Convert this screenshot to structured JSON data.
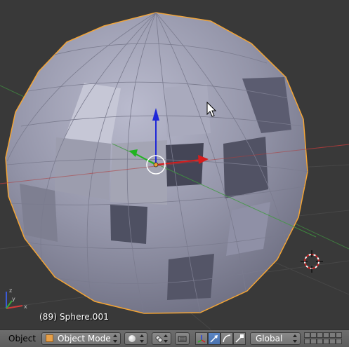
{
  "viewport": {
    "object_label": "(89) Sphere.001",
    "selection_outline_color": "#f5a534",
    "background_color": "#393939"
  },
  "header": {
    "menu_label": "Object",
    "mode_select": {
      "value": "Object Mode",
      "icon": "cube-mode-icon"
    },
    "shading_icon": "sphere-shading-icon",
    "pivot_icon": "pivot-point-icon",
    "snap_icon": "snap-magnet-icon",
    "manipulator_icons": [
      "manipulator-toggle-icon",
      "translate-icon",
      "rotate-icon",
      "scale-icon"
    ],
    "orientation_select": {
      "value": "Global"
    },
    "layers_icon": "layers-grid-icon"
  }
}
